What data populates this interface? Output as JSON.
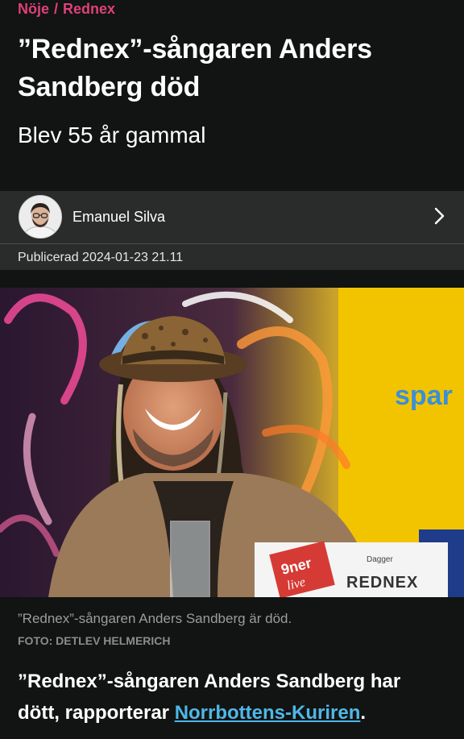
{
  "breadcrumb": {
    "section": "Nöje",
    "separator": "/",
    "topic": "Rednex"
  },
  "article": {
    "headline": "”Rednex”-sångaren Anders Sandberg död",
    "subtitle": "Blev 55 år gammal",
    "author": "Emanuel Silva",
    "published": "Publicerad 2024-01-23 21.11",
    "image_caption": "”Rednex”-sångaren Anders Sandberg är död.",
    "image_credit": "FOTO: DETLEV HELMERICH",
    "lead_text": "”Rednex”-sångaren Anders Sandberg har dött, rapporterar ",
    "lead_link": "Norrbottens-Kuriren",
    "lead_end": "."
  },
  "photo_signage": {
    "sponsor": "spar",
    "placard_title": "REDNEX",
    "placard_sub": "Dagger",
    "logo_top": "9ner",
    "logo_bottom": "live"
  },
  "colors": {
    "accent": "#e0407a",
    "link": "#4fb7e8",
    "background": "#111412",
    "author_bar": "#2a2c2b"
  },
  "icons": {
    "chevron": "chevron-right-icon",
    "avatar": "author-avatar"
  }
}
